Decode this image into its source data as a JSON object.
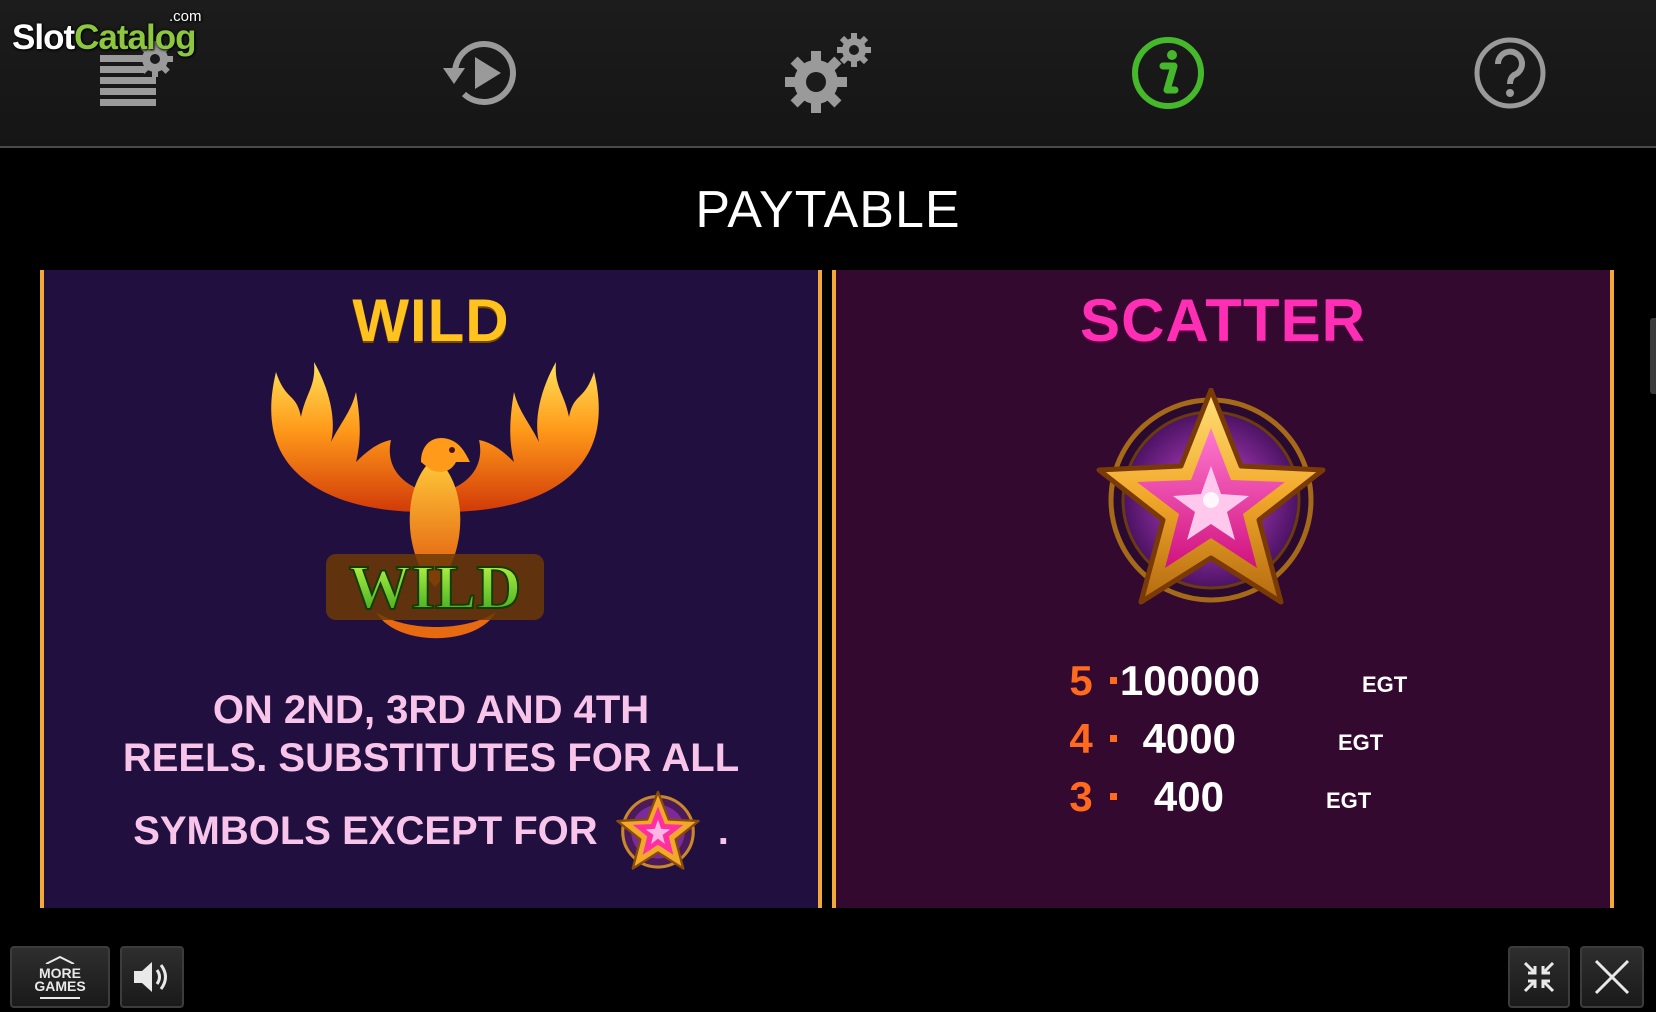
{
  "logo": {
    "slot": "Slot",
    "catalog": "Catalog",
    "com": ".com"
  },
  "toolbar": {
    "items": [
      {
        "icon": "paytable-settings-icon"
      },
      {
        "icon": "replay-icon"
      },
      {
        "icon": "settings-gears-icon"
      },
      {
        "icon": "info-icon",
        "active": true,
        "color": "#46b82c"
      },
      {
        "icon": "help-icon"
      }
    ]
  },
  "heading": "PAYTABLE",
  "wild": {
    "title": "WILD",
    "symbol_label": "WILD",
    "description_line1": "ON 2ND, 3RD AND 4TH",
    "description_line2": "REELS. SUBSTITUTES FOR ALL",
    "description_line3": "SYMBOLS EXCEPT FOR",
    "description_end": ".",
    "title_color": "#ffc21f",
    "text_color": "#f8c4ea"
  },
  "scatter": {
    "title": "SCATTER",
    "title_color": "#ff2fb5",
    "pays": [
      {
        "count": "5",
        "amount": "100000",
        "unit": "EGT"
      },
      {
        "count": "4",
        "amount": "4000",
        "unit": "EGT"
      },
      {
        "count": "3",
        "amount": "400",
        "unit": "EGT"
      }
    ]
  },
  "bottom": {
    "more_games_line1": "MORE",
    "more_games_line2": "GAMES",
    "sound_icon": "speaker-icon",
    "collapse_icon": "collapse-arrows-icon",
    "close_icon": "close-icon"
  },
  "colors": {
    "panel_border": "#f3a93a",
    "wild_panel_bg": "#21103f",
    "scatter_panel_bg": "#33092f",
    "count_color": "#ff6a1f"
  }
}
